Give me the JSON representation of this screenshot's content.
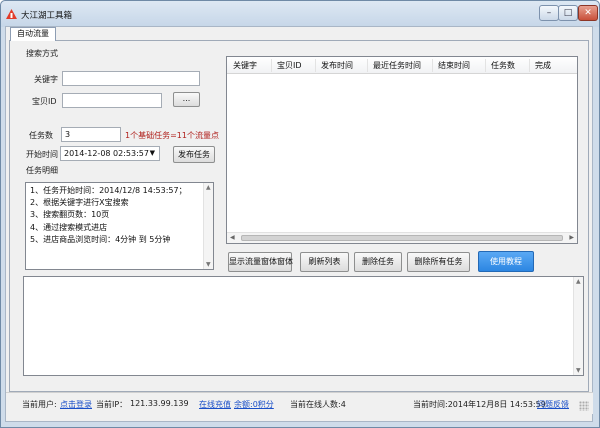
{
  "window": {
    "title": "大江湖工具箱",
    "controls": {
      "minimize": "–",
      "maximize": "□",
      "close": "✕"
    }
  },
  "tabs": [
    {
      "label": "自动流量",
      "active": true
    }
  ],
  "search": {
    "group_label": "搜索方式",
    "keyword_label": "关键字",
    "keyword_value": "",
    "item_id_label": "宝贝ID",
    "item_id_value": "",
    "browse_button": "..."
  },
  "task": {
    "count_label": "任务数",
    "count_value": "3",
    "count_hint": "1个基础任务=11个流量点",
    "start_time_label": "开始时间",
    "start_time_value": "2014-12-08 02:53:57",
    "publish_button": "发布任务",
    "detail_label": "任务明细",
    "details": [
      "1、任务开始时间：2014/12/8 14:53:57；",
      "2、根据关键字进行X宝搜索",
      "3、搜索翻页数：10页",
      "4、通过搜索模式进店",
      "5、进店商品浏览时间：4分钟 到 5分钟"
    ]
  },
  "table": {
    "columns": [
      "关键字",
      "宝贝ID",
      "发布时间",
      "最近任务时间",
      "结束时间",
      "任务数",
      "完成"
    ],
    "rows": []
  },
  "actions": {
    "show_main": "显示流量窗体窗体",
    "refresh": "刷新列表",
    "delete": "删除任务",
    "delete_all": "删除所有任务",
    "tutorial": "使用教程"
  },
  "status": {
    "user_label": "当前用户:",
    "login_link": "点击登录",
    "ip_label": "当前IP：",
    "ip_value": "121.33.99.139",
    "recharge_link": "在线充值",
    "balance_link": "余额:0积分",
    "online_label": "当前在线人数:4",
    "time_label": "当前时间:2014年12月8日 14:53:59",
    "feedback_link": "问题反馈"
  },
  "colors": {
    "accent_blue": "#2c86e2",
    "hint_red": "#b0201c",
    "link_blue": "#1a4fc8"
  },
  "icons": {
    "app": "app-icon",
    "dropdown": "chevron-down-icon",
    "scroll": "scroll-arrow-icon"
  }
}
